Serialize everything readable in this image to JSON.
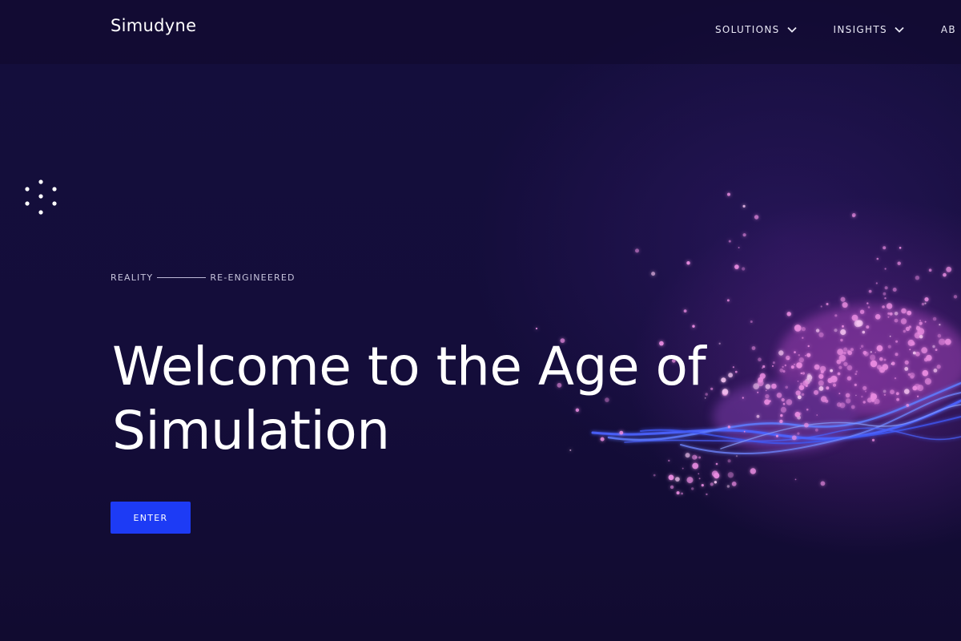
{
  "header": {
    "logo_text": "Simudyne",
    "nav": [
      {
        "label": "SOLUTIONS",
        "icon": "chevron-down-icon"
      },
      {
        "label": "INSIGHTS",
        "icon": "chevron-down-icon"
      },
      {
        "label": "AB"
      }
    ]
  },
  "hero": {
    "tagline_left": "REALITY",
    "tagline_right": "RE-ENGINEERED",
    "headline_line1": "Welcome to the Age of",
    "headline_line2": "Simulation",
    "cta_label": "ENTER",
    "side_icon": "dots-circle-icon"
  },
  "colors": {
    "background": "#120c35",
    "cta": "#1d3bf5",
    "particle_pink": "#e88be0",
    "particle_blue": "#4f6cff"
  }
}
